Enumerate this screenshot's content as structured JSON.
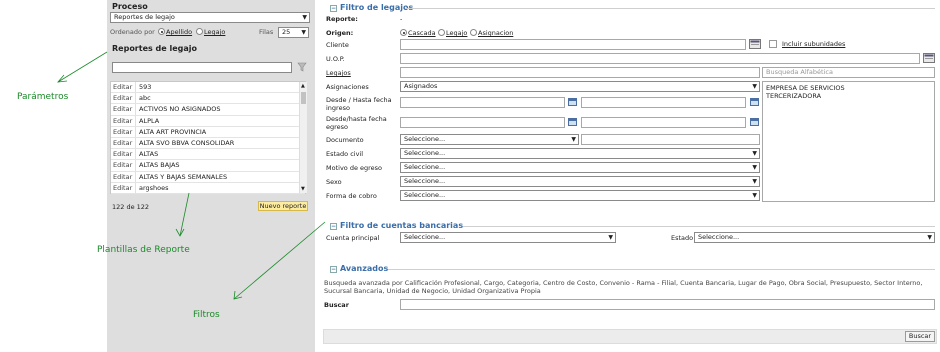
{
  "left": {
    "proceso_label": "Proceso",
    "proceso_value": "Reportes de legajo",
    "ordenado_label": "Ordenado por",
    "ordenado_options": [
      "Apellido",
      "Legajo"
    ],
    "filas_label": "Filas",
    "filas_value": "25",
    "reportes_title": "Reportes de legajo",
    "edit_label": "Editar",
    "items": [
      "593",
      "abc",
      "ACTIVOS NO ASIGNADOS",
      "ALPLA",
      "ALTA ART PROVINCIA",
      "ALTA SVO BBVA CONSOLIDAR",
      "ALTAS",
      "ALTAS BAJAS",
      "ALTAS Y BAJAS SEMANALES",
      "argshoes"
    ],
    "count_text": "122 de 122",
    "nuevo_reporte": "Nuevo reporte"
  },
  "annotations": {
    "parametros": "Parámetros",
    "plantillas": "Plantillas de Reporte",
    "filtros": "Filtros"
  },
  "filtro_legajos": {
    "title": "Filtro de legajos",
    "reporte_label": "Reporte:",
    "reporte_value": "-",
    "origen_label": "Origen:",
    "origen_options": [
      "Cascada",
      "Legajo",
      "Asignacion"
    ],
    "cliente_label": "Cliente",
    "incluir_label": "Incluir subunidades",
    "uop_label": "U.O.P.",
    "legajos_label": "Legajos",
    "busqueda_placeholder": "Busqueda Alfabética",
    "asignaciones_label": "Asignaciones",
    "asignaciones_value": "Asignados",
    "asignaciones_list": [
      "EMPRESA DE SERVICIOS",
      "TERCERIZADORA"
    ],
    "desde_hasta_ingreso_label": "Desde / Hasta fecha ingreso",
    "desde_hasta_egreso_label": "Desde/hasta fecha egreso",
    "documento_label": "Documento",
    "estado_civil_label": "Estado civil",
    "motivo_egreso_label": "Motivo de egreso",
    "sexo_label": "Sexo",
    "forma_cobro_label": "Forma de cobro",
    "seleccione": "Seleccione..."
  },
  "filtro_cuentas": {
    "title": "Filtro de cuentas bancarias",
    "cuenta_principal_label": "Cuenta principal",
    "estado_label": "Estado",
    "seleccione": "Seleccione..."
  },
  "avanzados": {
    "title": "Avanzados",
    "description": "Busqueda avanzada por Calificación Profesional, Cargo, Categoria, Centro de Costo, Convenio - Rama - Filial, Cuenta Bancaria, Lugar de Pago, Obra Social, Presupuesto, Sector Interno, Sucursal Bancaria, Unidad de Negocio, Unidad Organizativa Propia",
    "buscar_label": "Buscar",
    "buscar_button": "Buscar"
  }
}
